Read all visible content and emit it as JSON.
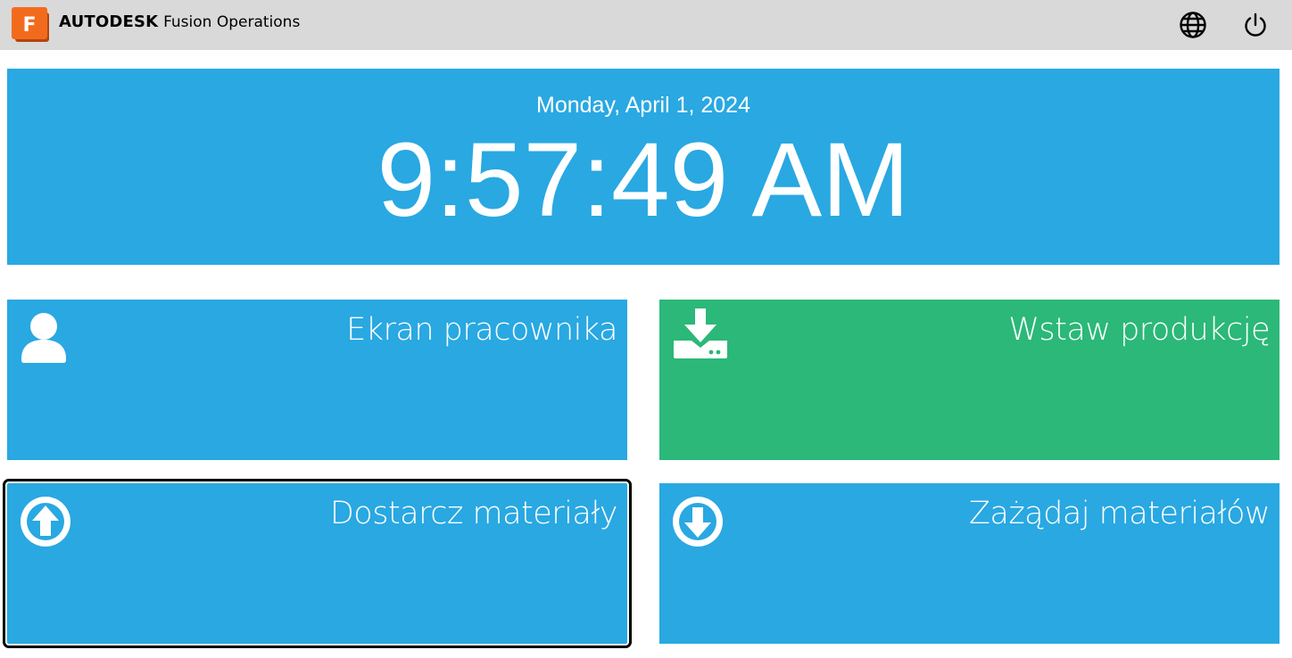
{
  "header": {
    "brand_bold": "AUTODESK",
    "brand_product": "Fusion Operations",
    "logo_letter": "F",
    "icons": [
      "globe-icon",
      "power-icon"
    ]
  },
  "clock": {
    "date": "Monday, April 1, 2024",
    "time": "9:57:49 AM"
  },
  "tiles": [
    {
      "label": "Ekran pracownika",
      "icon": "user-icon",
      "color": "#29a8e2"
    },
    {
      "label": "Wstaw produkcję",
      "icon": "download-tray-icon",
      "color": "#2bb878"
    },
    {
      "label": "Dostarcz materiały",
      "icon": "arrow-up-circle-icon",
      "color": "#29a8e2",
      "focused": true
    },
    {
      "label": "Zażądaj materiałów",
      "icon": "arrow-down-circle-icon",
      "color": "#29a8e2"
    }
  ],
  "colors": {
    "header_bg": "#d9d9d9",
    "tile_blue": "#29a8e2",
    "tile_green": "#2bb878",
    "logo_orange": "#f26b1d"
  }
}
